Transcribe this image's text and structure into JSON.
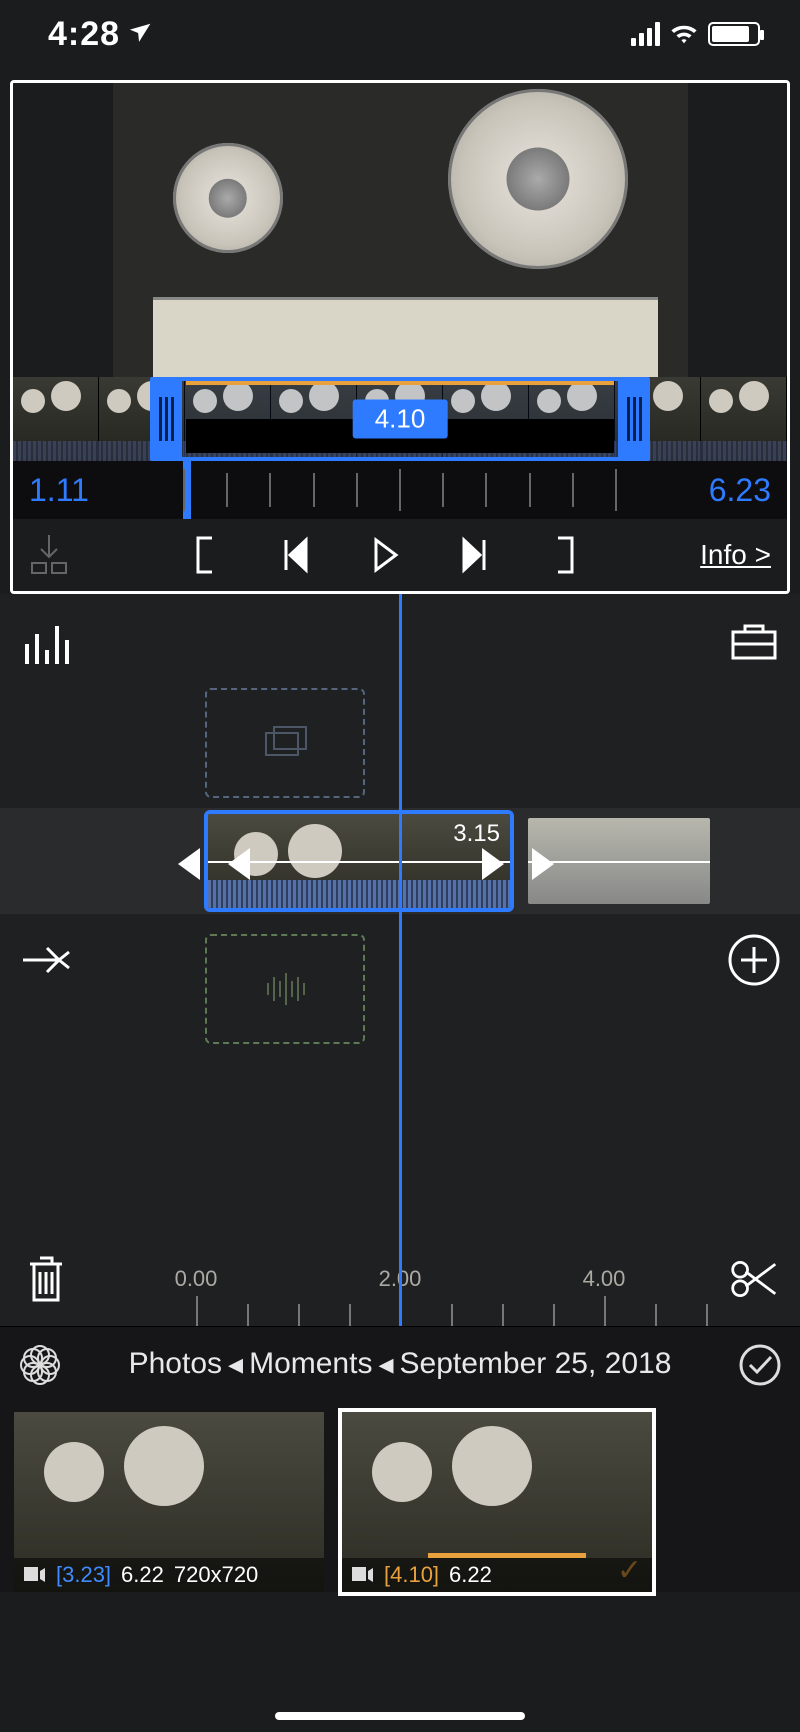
{
  "status": {
    "time": "4:28"
  },
  "preview": {
    "selection_duration": "4.10",
    "in_time": "1.11",
    "out_time": "6.23",
    "info_label": "Info >"
  },
  "timeline": {
    "clip_duration": "3.15",
    "ruler": {
      "t0": "0.00",
      "t1": "2.00",
      "t2": "4.00"
    }
  },
  "breadcrumb": {
    "root": "Photos",
    "mid": "Moments",
    "leaf": "September 25, 2018"
  },
  "media": {
    "item1": {
      "sel_dur": "[3.23]",
      "total": "6.22",
      "res": "720x720"
    },
    "item2": {
      "sel_dur": "[4.10]",
      "total": "6.22"
    }
  }
}
